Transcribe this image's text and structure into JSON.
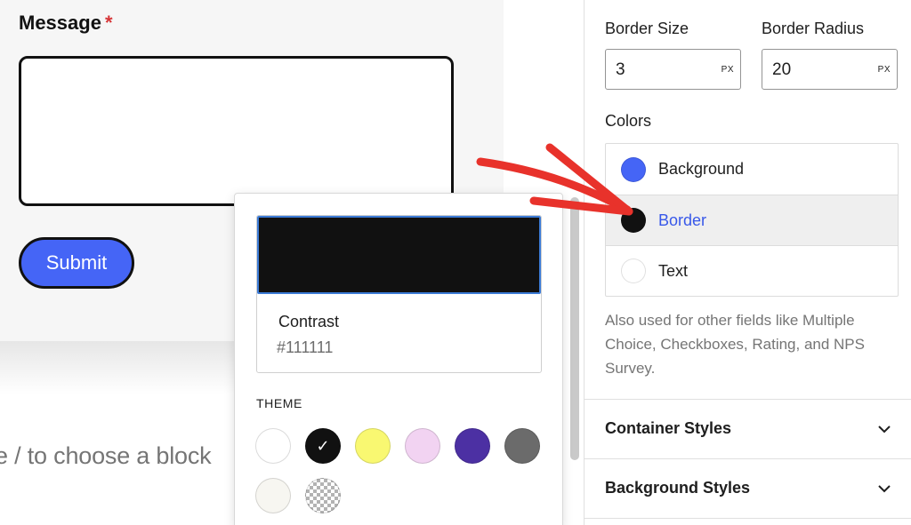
{
  "form": {
    "message_label": "Message",
    "required_marker": "*",
    "submit_label": "Submit",
    "block_placeholder": "e / to choose a block"
  },
  "color_picker": {
    "selected_name": "Contrast",
    "selected_hex": "#111111",
    "selected_color": "#111111",
    "theme_heading": "THEME",
    "theme_swatches": [
      {
        "name": "white",
        "color": "#ffffff",
        "selected": false
      },
      {
        "name": "contrast",
        "color": "#111111",
        "selected": true
      },
      {
        "name": "yellow",
        "color": "#f9f871",
        "selected": false
      },
      {
        "name": "pink",
        "color": "#f2d3f2",
        "selected": false
      },
      {
        "name": "purple",
        "color": "#4c30a3",
        "selected": false
      },
      {
        "name": "gray",
        "color": "#6b6b6b",
        "selected": false
      },
      {
        "name": "off-white",
        "color": "#f7f6f1",
        "selected": false
      },
      {
        "name": "transparent",
        "color": "checkerboard",
        "selected": false
      }
    ]
  },
  "sidebar": {
    "border_size_label": "Border Size",
    "border_size_value": "3",
    "border_radius_label": "Border Radius",
    "border_radius_value": "20",
    "unit": "PX",
    "colors_label": "Colors",
    "colors": [
      {
        "label": "Background",
        "color": "#4565f6",
        "active": false
      },
      {
        "label": "Border",
        "color": "#111111",
        "active": true
      },
      {
        "label": "Text",
        "color": "#ffffff",
        "active": false
      }
    ],
    "help_text": "Also used for other fields like Multiple Choice, Checkboxes, Rating, and NPS Survey.",
    "panels": [
      {
        "title": "Container Styles"
      },
      {
        "title": "Background Styles"
      }
    ]
  },
  "accent_colors": {
    "submit_button": "#4565f6",
    "active_link": "#3858e9",
    "annotation_arrow": "#e8322b"
  }
}
